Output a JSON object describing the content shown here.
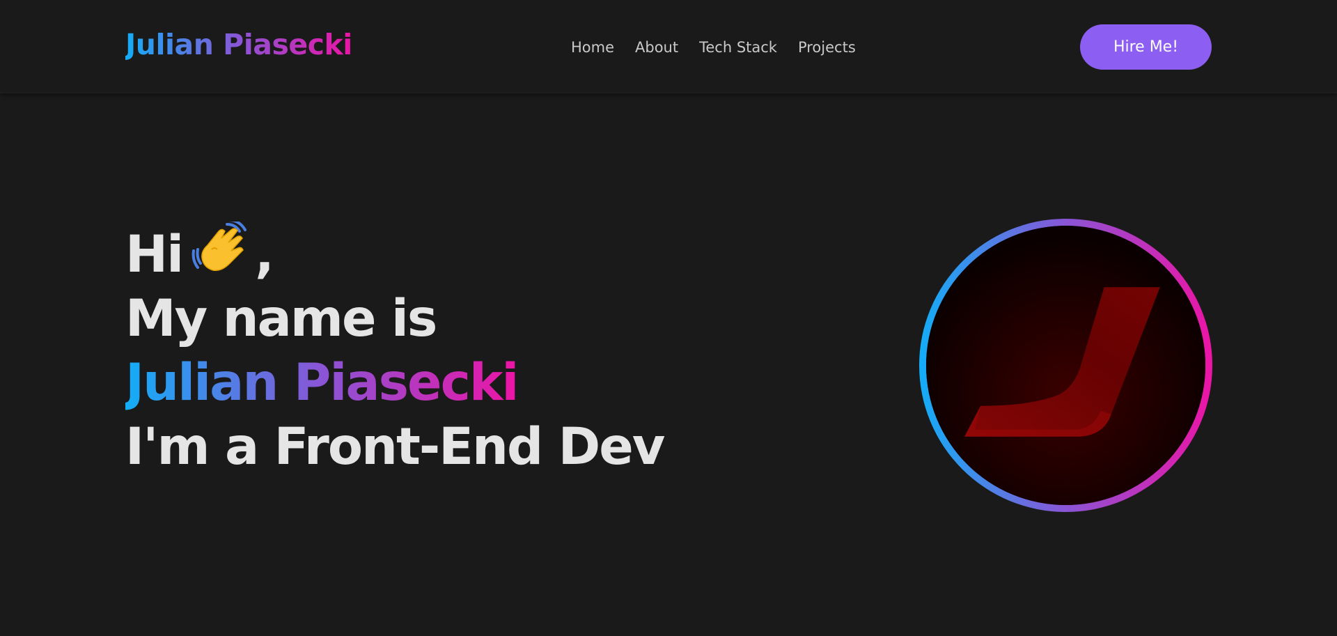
{
  "header": {
    "logo_text": "Julian Piasecki",
    "nav": [
      {
        "label": "Home"
      },
      {
        "label": "About"
      },
      {
        "label": "Tech Stack"
      },
      {
        "label": "Projects"
      }
    ],
    "hire_label": "Hire Me!"
  },
  "hero": {
    "greeting": "Hi",
    "greeting_icon": "waving-hand-icon",
    "greeting_comma": ",",
    "line2": "My name is",
    "name": "Julian Piasecki",
    "line4": "I'm a Front-End Dev"
  },
  "avatar": {
    "icon": "j-logo-avatar"
  },
  "colors": {
    "background": "#1a1a1a",
    "gradient_start": "#13adf7",
    "gradient_mid": "#8a55d6",
    "gradient_end": "#ec14a5",
    "button": "#8d5ef2",
    "text_light": "#e5e5e5",
    "nav_text": "#c9c9c9"
  }
}
